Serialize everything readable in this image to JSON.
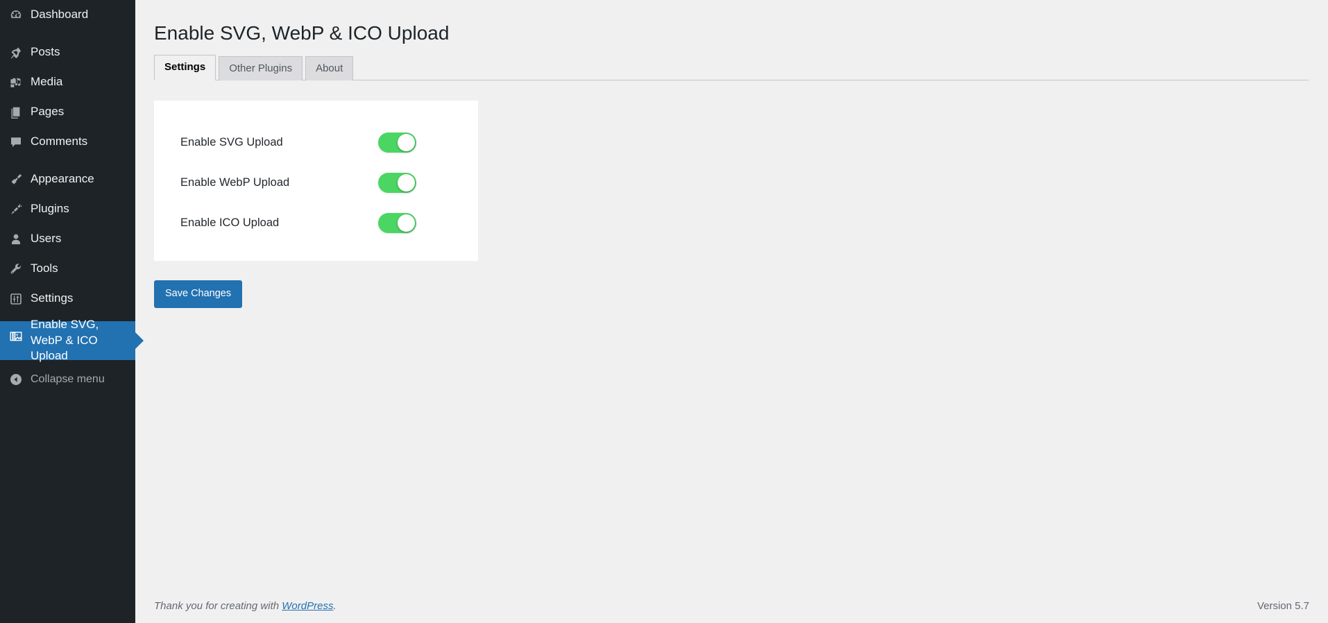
{
  "sidebar": {
    "items": [
      {
        "label": "Dashboard",
        "icon": "dashboard-icon",
        "name": "sidebar-item-dashboard",
        "separator_after": true
      },
      {
        "label": "Posts",
        "icon": "pin-icon",
        "name": "sidebar-item-posts",
        "separator_after": false
      },
      {
        "label": "Media",
        "icon": "media-icon",
        "name": "sidebar-item-media",
        "separator_after": false
      },
      {
        "label": "Pages",
        "icon": "pages-icon",
        "name": "sidebar-item-pages",
        "separator_after": false
      },
      {
        "label": "Comments",
        "icon": "comment-icon",
        "name": "sidebar-item-comments",
        "separator_after": true
      },
      {
        "label": "Appearance",
        "icon": "paintbrush-icon",
        "name": "sidebar-item-appearance",
        "separator_after": false
      },
      {
        "label": "Plugins",
        "icon": "plug-icon",
        "name": "sidebar-item-plugins",
        "separator_after": false
      },
      {
        "label": "Users",
        "icon": "user-icon",
        "name": "sidebar-item-users",
        "separator_after": false
      },
      {
        "label": "Tools",
        "icon": "wrench-icon",
        "name": "sidebar-item-tools",
        "separator_after": false
      },
      {
        "label": "Settings",
        "icon": "sliders-icon",
        "name": "sidebar-item-settings",
        "separator_after": true
      }
    ],
    "current_item": {
      "label": "Enable SVG, WebP & ICO Upload",
      "icon": "images-stack-icon",
      "name": "sidebar-item-enable-svg-webp-ico-upload"
    },
    "collapse": {
      "label": "Collapse menu",
      "icon": "collapse-arrow-icon"
    },
    "colors": {
      "background": "#1d2327",
      "active": "#2271b1",
      "text": "#f0f0f1",
      "muted": "#a7aaad"
    }
  },
  "header": {
    "title": "Enable SVG, WebP & ICO Upload"
  },
  "tabs": [
    {
      "label": "Settings",
      "active": true
    },
    {
      "label": "Other Plugins",
      "active": false
    },
    {
      "label": "About",
      "active": false
    }
  ],
  "settings": {
    "rows": [
      {
        "label": "Enable SVG Upload",
        "enabled": true
      },
      {
        "label": "Enable WebP Upload",
        "enabled": true
      },
      {
        "label": "Enable ICO Upload",
        "enabled": true
      }
    ]
  },
  "actions": {
    "save_label": "Save Changes",
    "save_color": "#2271b1"
  },
  "footer": {
    "thanks_prefix": "Thank you for creating with ",
    "wordpress_link": "WordPress",
    "thanks_suffix": ".",
    "version": "Version 5.7"
  }
}
